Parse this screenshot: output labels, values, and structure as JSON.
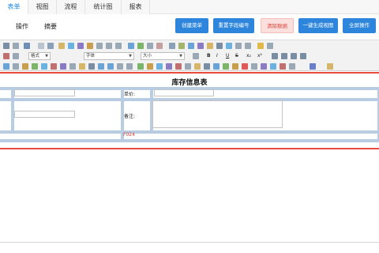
{
  "tabs": [
    {
      "label": "表单",
      "active": true
    },
    {
      "label": "视图",
      "active": false
    },
    {
      "label": "流程",
      "active": false
    },
    {
      "label": "统计图",
      "active": false
    },
    {
      "label": "报表",
      "active": false
    }
  ],
  "subtabs": [
    "操作",
    "摘要"
  ],
  "actions": {
    "create_table": "创建菜单",
    "reset_field_numbers": "重置字段编号",
    "clear_data": "清除数据",
    "generate_view": "一键生成视图",
    "full_operation": "全屏操作"
  },
  "editor": {
    "format_select": "格式",
    "font_select": "字体",
    "size_select": "大小",
    "format_buttons": [
      "B",
      "I",
      "U",
      "S",
      "x₂",
      "x²"
    ]
  },
  "form": {
    "title": "库存信息表",
    "unit_price_label": "单价:",
    "remarks_label": "备注:",
    "form_code": "F024"
  },
  "colors": {
    "accent": "#2d86dc",
    "danger": "#e0473e",
    "red_line": "#e74c3c"
  }
}
